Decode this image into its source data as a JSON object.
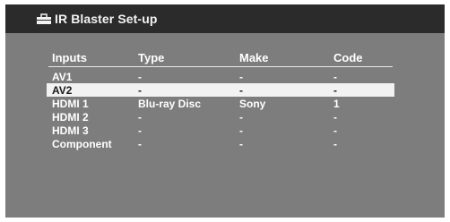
{
  "title": "IR Blaster Set-up",
  "headers": {
    "inputs": "Inputs",
    "type": "Type",
    "make": "Make",
    "code": "Code"
  },
  "rows": [
    {
      "input": "AV1",
      "type": "-",
      "make": "-",
      "code": "-"
    },
    {
      "input": "AV2",
      "type": "-",
      "make": "-",
      "code": "-"
    },
    {
      "input": "HDMI 1",
      "type": "Blu-ray Disc",
      "make": "Sony",
      "code": "1"
    },
    {
      "input": "HDMI 2",
      "type": "-",
      "make": "-",
      "code": "-"
    },
    {
      "input": "HDMI 3",
      "type": "-",
      "make": "-",
      "code": "-"
    },
    {
      "input": "Component",
      "type": "-",
      "make": "-",
      "code": "-"
    }
  ],
  "selected_row": "AV2",
  "icon": "toolbox-icon"
}
